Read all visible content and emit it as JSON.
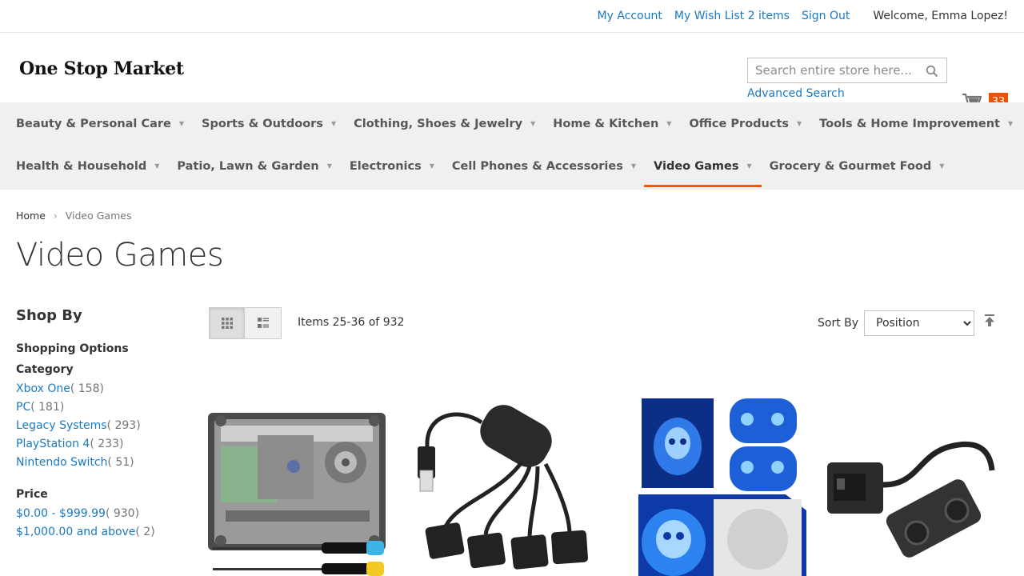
{
  "header_links": {
    "my_account": "My Account",
    "wish_list": "My Wish List 2 items",
    "sign_out": "Sign Out",
    "welcome": "Welcome, Emma Lopez!"
  },
  "logo_text": "One Stop Market",
  "search": {
    "placeholder": "Search entire store here...",
    "advanced": "Advanced Search"
  },
  "cart": {
    "count": "33"
  },
  "nav": {
    "row1": [
      "Beauty & Personal Care",
      "Sports & Outdoors",
      "Clothing, Shoes & Jewelry",
      "Home & Kitchen",
      "Office Products",
      "Tools & Home Improvement"
    ],
    "row2": [
      "Health & Household",
      "Patio, Lawn & Garden",
      "Electronics",
      "Cell Phones & Accessories",
      "Video Games",
      "Grocery & Gourmet Food"
    ],
    "active": "Video Games"
  },
  "breadcrumb": {
    "home": "Home",
    "current": "Video Games"
  },
  "page_title": "Video Games",
  "sidebar": {
    "shop_by": "Shop By",
    "shopping_options": "Shopping Options",
    "category_title": "Category",
    "categories": [
      {
        "label": "Xbox One",
        "count": "( 158)"
      },
      {
        "label": "PC",
        "count": "( 181)"
      },
      {
        "label": "Legacy Systems",
        "count": "( 293)"
      },
      {
        "label": "PlayStation 4",
        "count": "( 233)"
      },
      {
        "label": "Nintendo Switch",
        "count": "( 51)"
      }
    ],
    "price_title": "Price",
    "prices": [
      {
        "label": "$0.00 - $999.99",
        "count": "( 930)"
      },
      {
        "label": "$1,000.00 and above",
        "count": "( 2)"
      }
    ]
  },
  "toolbar": {
    "amount": "Items 25-36 of 932",
    "sort_by_label": "Sort By",
    "sort_options": [
      "Position"
    ],
    "sort_selected": "Position"
  },
  "products": [
    {
      "icon": "dvd-drive-with-screwdrivers"
    },
    {
      "icon": "usb-hub-cable"
    },
    {
      "icon": "blue-skull-console-skin"
    },
    {
      "icon": "xbox-power-adapter-cable"
    }
  ],
  "colors": {
    "link": "#1979c3",
    "accent": "#ff5501",
    "cart_badge": "#eb5202",
    "nav_bg": "#f0f0f0"
  }
}
